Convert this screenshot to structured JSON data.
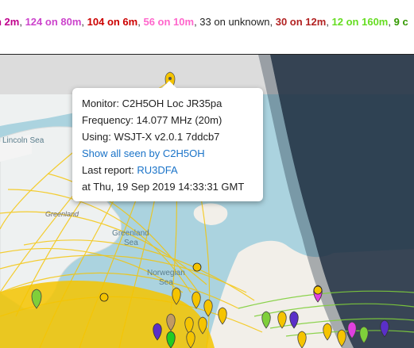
{
  "band_summary": {
    "items": [
      {
        "text": "n 2m",
        "color": "#c0008c"
      },
      {
        "text": "124 on 80m",
        "color": "#cc44cc"
      },
      {
        "text": "104 on 6m",
        "color": "#cc0000"
      },
      {
        "text": "56 on 10m",
        "color": "#ff66cc"
      },
      {
        "text": "33 on unknown",
        "color": "#222222"
      },
      {
        "text": "30 on 12m",
        "color": "#b22222"
      },
      {
        "text": "12 on 160m",
        "color": "#66dd22"
      },
      {
        "text": "9 c",
        "color": "#339900"
      }
    ]
  },
  "map": {
    "labels": {
      "lincoln_sea": "Lincoln Sea",
      "greenland_land": "Greenland",
      "greenland_sea_1": "Greenland",
      "greenland_sea_2": "Sea",
      "norwegian_sea_1": "Norwegian",
      "norwegian_sea_2": "Sea"
    },
    "colors": {
      "ocean": "#abd3df",
      "land": "#f2efe9",
      "ice": "#eef1f1",
      "night": "#1e2d40",
      "arc_yellow": "#f5c400",
      "arc_green": "#7fcf3a"
    }
  },
  "popup": {
    "monitor": "Monitor: C2H5OH Loc JR35pa",
    "frequency": "Frequency: 14.077 MHz (20m)",
    "using": "Using: WSJT-X v2.0.1 7ddcb7",
    "show_all_link": "Show all seen by C2H5OH",
    "last_report_label": "Last report: ",
    "last_report_link": "RU3DFA",
    "timestamp": "at Thu, 19 Sep 2019 14:33:31 GMT"
  }
}
